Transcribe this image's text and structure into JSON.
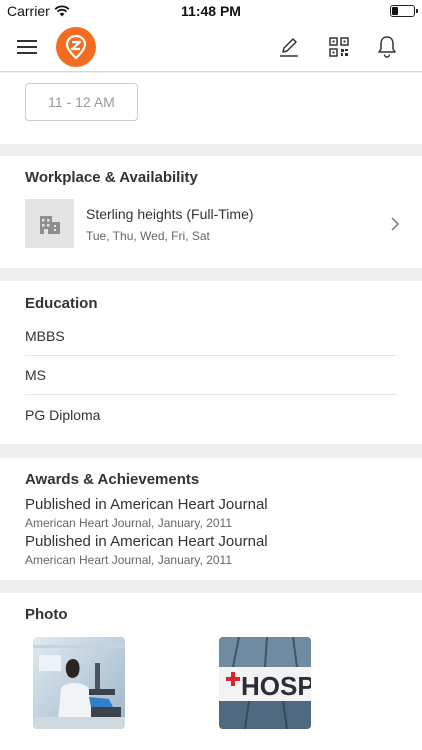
{
  "status_bar": {
    "carrier": "Carrier",
    "time": "11:48 PM"
  },
  "navbar": {
    "icons": [
      "menu-icon",
      "logo-icon",
      "edit-icon",
      "qr-code-icon",
      "bell-icon"
    ],
    "brand_color": "#f36c21"
  },
  "availability": {
    "time_slot": "11 - 12 AM"
  },
  "workplace": {
    "title": "Workplace & Availability",
    "name": "Sterling heights  (Full-Time)",
    "days": "Tue, Thu, Wed, Fri, Sat"
  },
  "education": {
    "title": "Education",
    "items": [
      "MBBS",
      "MS",
      "PG Diploma"
    ]
  },
  "awards": {
    "title": "Awards & Achievements",
    "items": [
      {
        "title": "Published in American Heart Journal",
        "subtitle": "American Heart Journal, January, 2011"
      },
      {
        "title": "Published in American Heart Journal",
        "subtitle": "American Heart Journal, January, 2011"
      }
    ]
  },
  "photos": {
    "title": "Photo",
    "items": [
      {
        "name": "lab-scientist-photo"
      },
      {
        "name": "hospital-sign-photo",
        "sign_text": "HOSP"
      }
    ]
  }
}
